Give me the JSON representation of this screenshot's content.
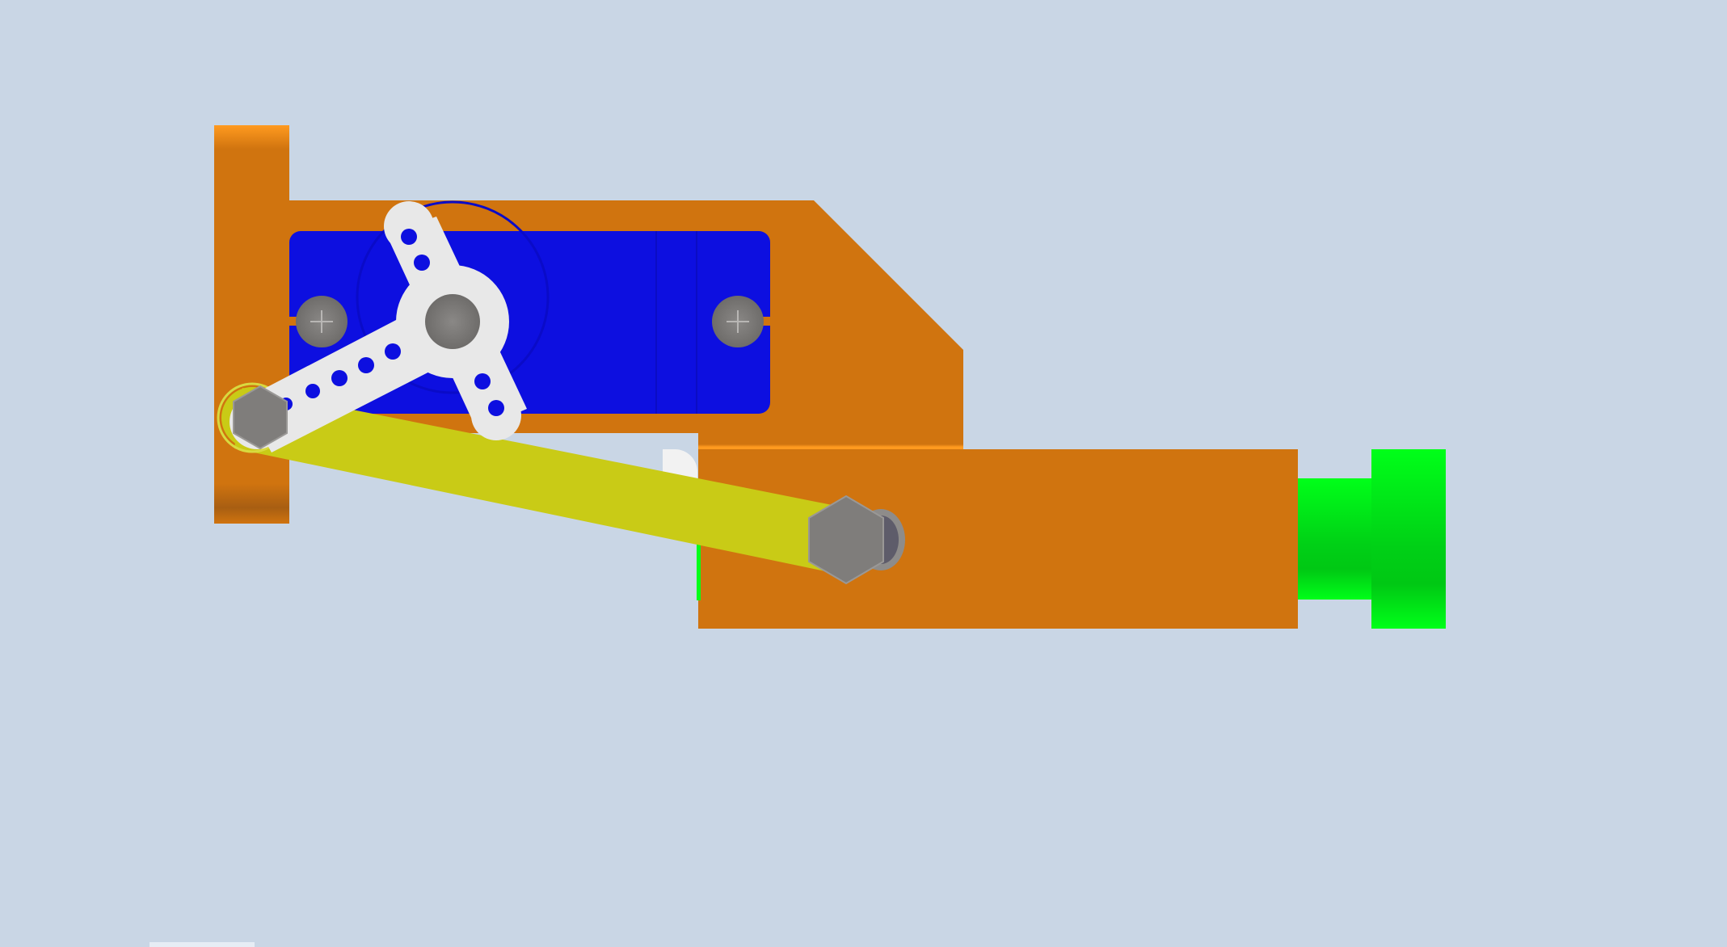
{
  "scene": {
    "background": "#C9D6E5",
    "colors": {
      "bracket_orange": "#D0740F",
      "bracket_highlight": "#FF9A1F",
      "bracket_shadow": "#A85E12",
      "servo_blue": "#0D0FE0",
      "servo_horn": "#E8E8E8",
      "linkage_yellow": "#C9CB16",
      "bolt_grey": "#7F7D7B",
      "end_cap_green": "#00FF19",
      "end_cap_green_shadow": "#00C814"
    },
    "parts": [
      "vertical-mounting-plate-icon",
      "servo-bracket-icon",
      "servo-body-icon",
      "servo-horn-icon",
      "linkage-arm-icon",
      "slider-block-icon",
      "end-cap-icon",
      "hex-bolt-icon",
      "screw-icon"
    ]
  }
}
